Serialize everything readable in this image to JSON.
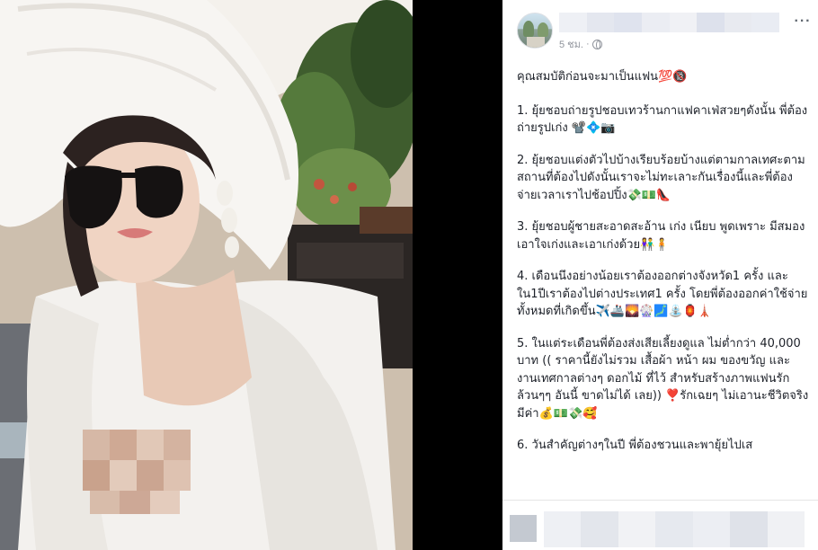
{
  "post": {
    "timestamp": "5 ชม.",
    "timestamp_separator": "·",
    "more_label": "···",
    "paragraphs": [
      "คุณสมบัติก่อนจะมาเป็นแฟน💯🔞",
      "1. ยุ้ยชอบถ่ายรูปชอบเทวร้านกาแฟคาเฟ่สวยๆดังนั้น พี่ต้องถ่ายรูปเก่ง 📽️💠📷",
      "2. ยุ้ยชอบแต่งตัวไปบ้างเรียบร้อยบ้างแต่ตามกาลเทศะตามสถานที่ต้องไปดังนั้นเราจะไม่ทะเลาะกันเรื่องนี้และพี่ต้องจ่ายเวลาเราไปช้อปปิ้ง💸💵👠",
      "3. ยุ้ยชอบผู้ชายสะอาดสะอ้าน เก่ง เนียบ พูดเพราะ มีสมอง เอาใจเก่งและเอาเก่งด้วย👫🧍",
      "4. เดือนนึงอย่างน้อยเราต้องออกต่างจังหวัด1 ครั้ง และใน1ปีเราต้องไปต่างประเทศ1 ครั้ง โดยพี่ต้องออกค่าใช้จ่ายทั้งหมดที่เกิดขึ้น✈️🚢🌄🎡🗾⛲🏮🗼",
      "5. ในแต่ระเดือนพี่ต้องส่งเสียเลี้ยงดูแล ไม่ต่ำกว่า 40,000 บาท (( ราคานี้ยังไม่รวม เสื้อผ้า หน้า ผม ของขวัญ และงานเทศกาลต่างๆ ดอกไม้ ที่ไว้ สำหรับสร้างภาพแฟนรักล้วนๆๆ อันนี้ ขาดไม่ได้ เลย)) ❣️รักเฉยๆ ไม่เอานะชีวิตจริงมีค่า💰💵💸🥰",
      "6. วันสำคัญต่างๆในปี พี่ต้องชวนและพายุ้ยไปเส"
    ]
  },
  "colors": {
    "text": "#1d2129",
    "meta": "#90949c",
    "blur_name": [
      "#e9ecf3",
      "#dfe3ee",
      "#ebedf3",
      "#f0f1f5",
      "#e4e7ef",
      "#dde1ec",
      "#e8eaf0",
      "#eef0f5"
    ],
    "censor_skin": [
      "#c9a896",
      "#d8b9a6",
      "#cfae9c",
      "#e0c6b6",
      "#c5a08c",
      "#d6b7a4"
    ]
  }
}
